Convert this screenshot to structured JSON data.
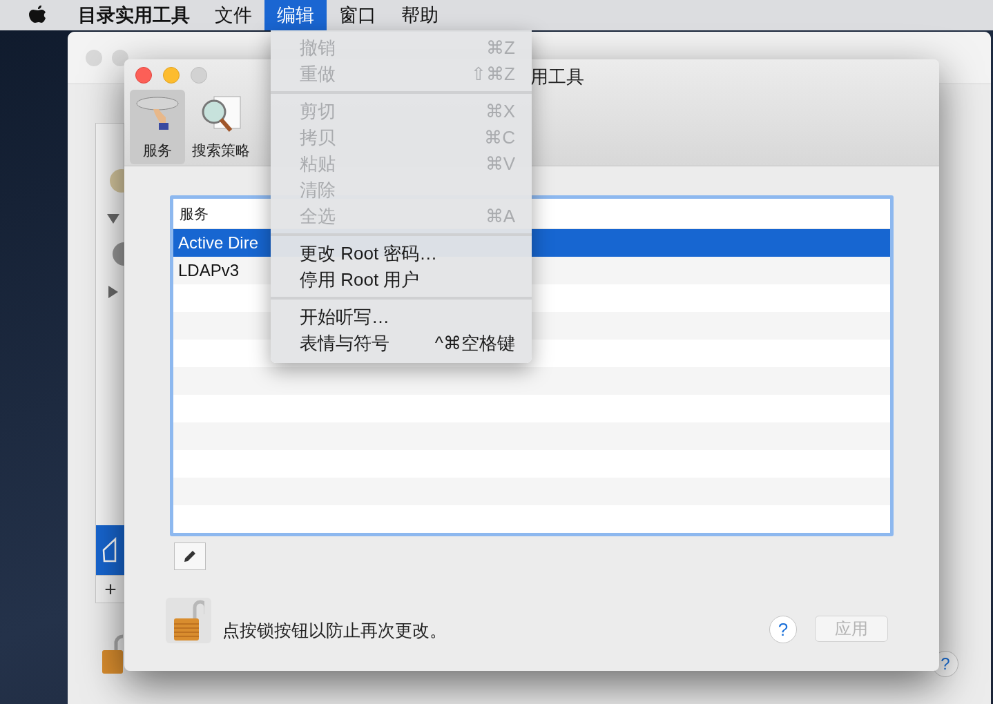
{
  "menubar": {
    "items": [
      {
        "label": "目录实用工具",
        "selected": false,
        "bold": true
      },
      {
        "label": "文件",
        "selected": false,
        "bold": false
      },
      {
        "label": "编辑",
        "selected": true,
        "bold": false
      },
      {
        "label": "窗口",
        "selected": false,
        "bold": false
      },
      {
        "label": "帮助",
        "selected": false,
        "bold": false
      }
    ]
  },
  "back_window": {
    "sidebar_add": "+",
    "help": "?"
  },
  "window": {
    "title": "用工具",
    "toolbar": [
      {
        "label": "服务",
        "selected": true
      },
      {
        "label": "搜索策略",
        "selected": false
      }
    ],
    "table": {
      "header": "服务",
      "rows": [
        {
          "label": "Active Dire",
          "selected": true
        },
        {
          "label": "LDAPv3",
          "selected": false
        }
      ]
    },
    "lock_text": "点按锁按钮以防止再次更改。",
    "help": "?",
    "apply": {
      "label": "应用",
      "disabled": true
    }
  },
  "menu": {
    "items": [
      {
        "kind": "item",
        "label": "撤销",
        "shortcut": "⌘Z",
        "disabled": true
      },
      {
        "kind": "item",
        "label": "重做",
        "shortcut": "⇧⌘Z",
        "disabled": true
      },
      {
        "kind": "separator"
      },
      {
        "kind": "item",
        "label": "剪切",
        "shortcut": "⌘X",
        "disabled": true
      },
      {
        "kind": "item",
        "label": "拷贝",
        "shortcut": "⌘C",
        "disabled": true
      },
      {
        "kind": "item",
        "label": "粘贴",
        "shortcut": "⌘V",
        "disabled": true
      },
      {
        "kind": "item",
        "label": "清除",
        "disabled": true
      },
      {
        "kind": "item",
        "label": "全选",
        "shortcut": "⌘A",
        "disabled": true
      },
      {
        "kind": "separator"
      },
      {
        "kind": "item",
        "label": "更改 Root 密码…",
        "disabled": false
      },
      {
        "kind": "item",
        "label": "停用 Root 用户",
        "disabled": false
      },
      {
        "kind": "separator"
      },
      {
        "kind": "item",
        "label": "开始听写…",
        "disabled": false
      },
      {
        "kind": "item",
        "label": "表情与符号",
        "shortcut": "^⌘空格键",
        "disabled": false
      }
    ]
  }
}
